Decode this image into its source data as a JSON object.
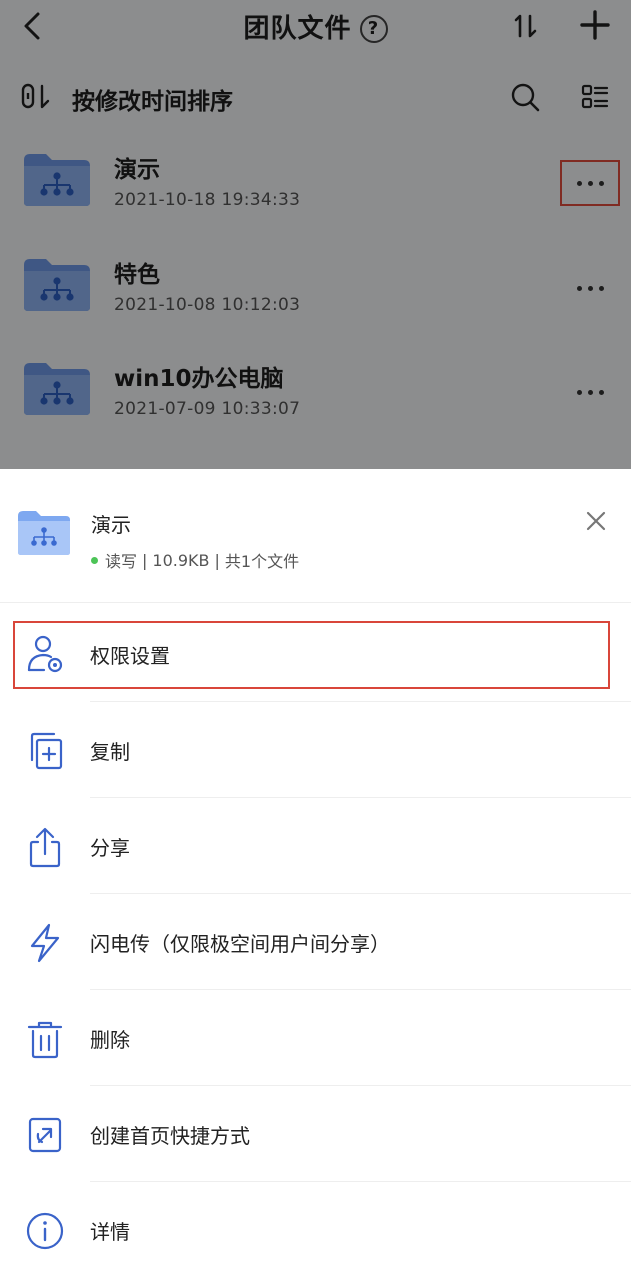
{
  "header": {
    "title": "团队文件",
    "help_label": "?",
    "sort_toggle_icon": "sort-toggle-icon",
    "add_icon": "plus-icon"
  },
  "sortbar": {
    "label": "按修改时间排序"
  },
  "files": [
    {
      "name": "演示",
      "date": "2021-10-18 19:34:33"
    },
    {
      "name": "特色",
      "date": "2021-10-08 10:12:03"
    },
    {
      "name": "win10办公电脑",
      "date": "2021-07-09 10:33:07"
    }
  ],
  "sheet": {
    "folder_name": "演示",
    "permission": "读写",
    "size": "10.9KB",
    "file_count": "共1个文件",
    "separator": "|"
  },
  "menu": [
    {
      "label": "权限设置",
      "icon": "user-settings-icon"
    },
    {
      "label": "复制",
      "icon": "copy-icon"
    },
    {
      "label": "分享",
      "icon": "share-icon"
    },
    {
      "label": "闪电传（仅限极空间用户间分享）",
      "icon": "lightning-icon"
    },
    {
      "label": "删除",
      "icon": "trash-icon"
    },
    {
      "label": "创建首页快捷方式",
      "icon": "shortcut-icon"
    },
    {
      "label": "详情",
      "icon": "info-icon"
    }
  ],
  "colors": {
    "accent": "#3a63c9",
    "folder": "#5b8fe6",
    "highlight": "#d9463a",
    "status_green": "#4cc457"
  }
}
